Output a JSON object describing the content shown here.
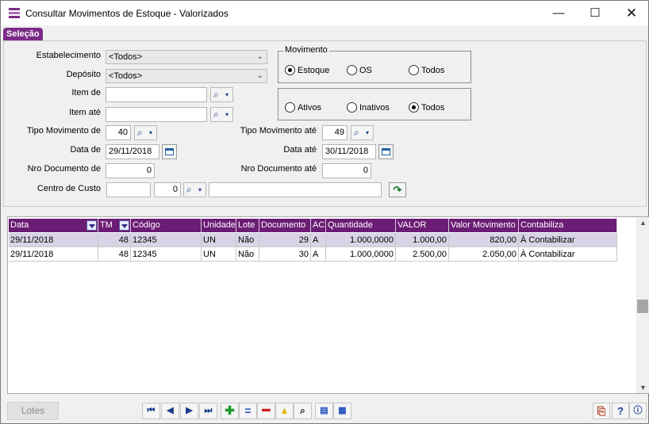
{
  "window": {
    "title": "Consultar Movimentos de Estoque - Valorizados",
    "minimize": "—",
    "maximize": "☐",
    "close": "✕"
  },
  "tab": {
    "label": "Seleção"
  },
  "form": {
    "estabelecimento": {
      "label": "Estabelecimento",
      "value": "<Todos>"
    },
    "deposito": {
      "label": "Depósito",
      "value": "<Todos>"
    },
    "item_de": {
      "label": "Item de",
      "value": ""
    },
    "item_ate": {
      "label": "Item até",
      "value": ""
    },
    "tipo_mov_de": {
      "label": "Tipo Movimento de",
      "value": "40"
    },
    "tipo_mov_ate": {
      "label": "Tipo Movimento até",
      "value": "49"
    },
    "data_de": {
      "label": "Data de",
      "value": "29/11/2018"
    },
    "data_ate": {
      "label": "Data até",
      "value": "30/11/2018"
    },
    "nro_doc_de": {
      "label": "Nro Documento de",
      "value": "0"
    },
    "nro_doc_ate": {
      "label": "Nro Documento até",
      "value": "0"
    },
    "centro_custo": {
      "label": "Centro de Custo",
      "value1": "",
      "value2": "0",
      "value3": ""
    }
  },
  "movimento_group": {
    "title": "Movimento",
    "options": [
      "Estoque",
      "OS",
      "Todos"
    ],
    "selected": "Estoque"
  },
  "status_group": {
    "options": [
      "Ativos",
      "Inativos",
      "Todos"
    ],
    "selected": "Todos"
  },
  "grid": {
    "columns": [
      "Data",
      "TM",
      "Código",
      "Unidade",
      "Lote",
      "Documento",
      "AC",
      "Quantidade",
      "VALOR",
      "Valor Movimento",
      "Contabiliza"
    ],
    "rows": [
      [
        "29/11/2018",
        "48",
        "12345",
        "UN",
        "Não",
        "29",
        "A",
        "1.000,0000",
        "1.000,00",
        "820,00",
        "À Contabilizar"
      ],
      [
        "29/11/2018",
        "48",
        "12345",
        "UN",
        "Não",
        "30",
        "A",
        "1.000,0000",
        "2.500,00",
        "2.050,00",
        "À Contabilizar"
      ]
    ],
    "selected_row": 0
  },
  "footer": {
    "lotes_label": "Lotes",
    "nav": {
      "first": "⏮",
      "prev": "◀",
      "next": "▶",
      "last": "⏭",
      "add": "✚",
      "edit": "=",
      "delete": "━",
      "post": "▲",
      "search": "⌕",
      "view": "▤",
      "export": "▦"
    },
    "exit": "⎘",
    "help": "?",
    "info": "ⓘ"
  },
  "icons": {
    "search": "⌕",
    "dropdown": "▾",
    "combo_arrow": "⌄",
    "go": "↷"
  },
  "colors": {
    "accent": "#6b1c74",
    "tab": "#7b2c86"
  }
}
